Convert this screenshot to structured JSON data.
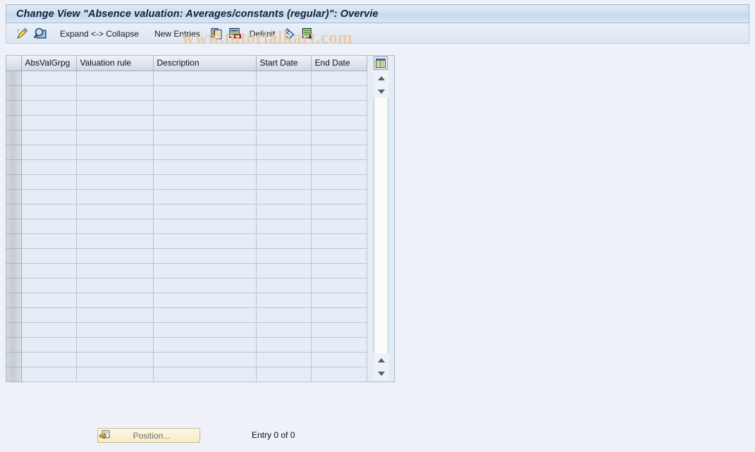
{
  "window": {
    "title": "Change View \"Absence valuation: Averages/constants (regular)\": Overvie"
  },
  "toolbar": {
    "items": [
      {
        "name": "display-change-icon",
        "type": "icon",
        "icon": "pencil-display-change-icon",
        "label": ""
      },
      {
        "name": "display-detail-icon",
        "type": "icon",
        "icon": "magnifier-display-icon",
        "label": ""
      },
      {
        "name": "expand-collapse-button",
        "type": "text",
        "label": "Expand <-> Collapse"
      },
      {
        "name": "new-entries-button",
        "type": "text",
        "label": "New Entries"
      },
      {
        "name": "copy-as-icon",
        "type": "icon",
        "icon": "copy-icon",
        "label": ""
      },
      {
        "name": "delete-icon",
        "type": "icon",
        "icon": "delete-row-icon",
        "label": ""
      },
      {
        "name": "delimit-button",
        "type": "text",
        "label": "Delimit"
      },
      {
        "name": "undo-icon",
        "type": "icon",
        "icon": "undo-arrow-icon",
        "label": ""
      },
      {
        "name": "select-all-icon",
        "type": "icon",
        "icon": "table-select-icon",
        "label": ""
      }
    ]
  },
  "watermark": {
    "text": "www.tutorialkart.com",
    "color": "#eccba2"
  },
  "table": {
    "columns": [
      {
        "key": "abs_val_grp",
        "label": "AbsValGrpg"
      },
      {
        "key": "valuation_rule",
        "label": "Valuation rule"
      },
      {
        "key": "description",
        "label": "Description"
      },
      {
        "key": "start_date",
        "label": "Start Date"
      },
      {
        "key": "end_date",
        "label": "End Date"
      }
    ],
    "rows": [],
    "empty_row_count": 21,
    "settings_icon": "table-settings-icon",
    "scroll": {
      "up_icon": "scroll-up-icon",
      "down_icon": "scroll-down-icon"
    }
  },
  "footer": {
    "position_button": {
      "label": "Position...",
      "icon": "position-icon"
    },
    "entry_status": "Entry 0 of 0"
  },
  "colors": {
    "background": "#eef2f8",
    "title_bar": "#cfdff1",
    "grid_cell": "#e7edf6",
    "accent_yellow": "#f5ecc9"
  }
}
